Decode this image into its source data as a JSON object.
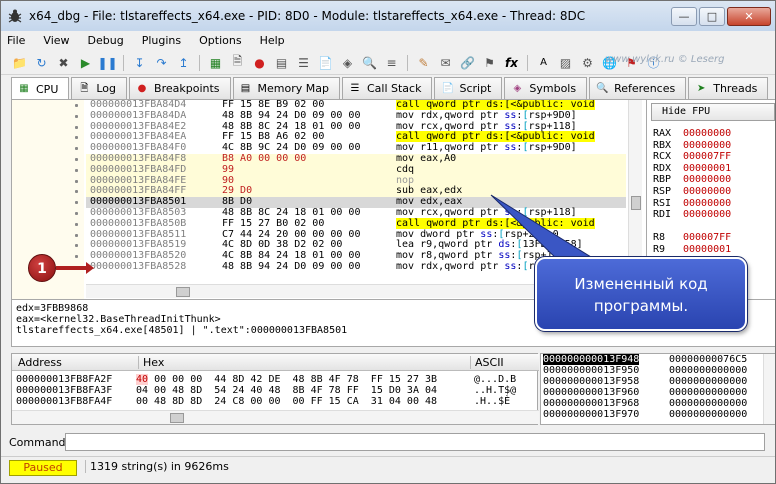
{
  "window": {
    "title": "x64_dbg - File: tlstareffects_x64.exe - PID: 8D0 - Module: tlstareffects_x64.exe - Thread: 8DC"
  },
  "menu": [
    "File",
    "View",
    "Debug",
    "Plugins",
    "Options",
    "Help"
  ],
  "watermark": "www.wylek.ru © Leserg",
  "tabs": [
    {
      "label": "CPU",
      "icon": "cpu-icon",
      "active": true
    },
    {
      "label": "Log",
      "icon": "log-icon"
    },
    {
      "label": "Breakpoints",
      "icon": "breakpoint-icon"
    },
    {
      "label": "Memory Map",
      "icon": "memory-icon"
    },
    {
      "label": "Call Stack",
      "icon": "callstack-icon"
    },
    {
      "label": "Script",
      "icon": "script-icon"
    },
    {
      "label": "Symbols",
      "icon": "symbols-icon"
    },
    {
      "label": "References",
      "icon": "references-icon"
    },
    {
      "label": "Threads",
      "icon": "threads-icon"
    }
  ],
  "disasm": [
    {
      "addr": "000000013FBA84D4",
      "bytes": "FF 15 8E B9 02 00",
      "instr": "call qword ptr ds:[<&public: void",
      "kind": "call"
    },
    {
      "addr": "000000013FBA84DA",
      "bytes": "48 8B 94 24 D0 09 00 00",
      "instr": "mov rdx,qword ptr ss:[rsp+9D0]"
    },
    {
      "addr": "000000013FBA84E2",
      "bytes": "48 8B 8C 24 18 01 00 00",
      "instr": "mov rcx,qword ptr ss:[rsp+118]"
    },
    {
      "addr": "000000013FBA84EA",
      "bytes": "FF 15 B8 A6 02 00",
      "instr": "call qword ptr ds:[<&public: void",
      "kind": "call"
    },
    {
      "addr": "000000013FBA84F0",
      "bytes": "4C 8B 9C 24 D0 09 00 00",
      "instr": "mov r11,qword ptr ss:[rsp+9D0]"
    },
    {
      "addr": "000000013FBA84F8",
      "bytes": "B8 A0 00 00 00",
      "instr": "mov eax,A0",
      "kind": "mod"
    },
    {
      "addr": "000000013FBA84FD",
      "bytes": "99",
      "instr": "cdq",
      "kind": "mod"
    },
    {
      "addr": "000000013FBA84FE",
      "bytes": "90",
      "instr": "nop",
      "kind": "mod"
    },
    {
      "addr": "000000013FBA84FF",
      "bytes": "29 D0",
      "instr": "sub eax,edx",
      "kind": "mod"
    },
    {
      "addr": "000000013FBA8501",
      "bytes": "8B D0",
      "instr": "mov edx,eax",
      "kind": "sel"
    },
    {
      "addr": "000000013FBA8503",
      "bytes": "48 8B 8C 24 18 01 00 00",
      "instr": "mov rcx,qword ptr ss:[rsp+118]"
    },
    {
      "addr": "000000013FBA850B",
      "bytes": "FF 15 27 B0 02 00",
      "instr": "call qword ptr ds:[<&public: void",
      "kind": "call"
    },
    {
      "addr": "000000013FBA8511",
      "bytes": "C7 44 24 20 00 00 00 00",
      "instr": "mov dword ptr ss:[rsp+20],0"
    },
    {
      "addr": "000000013FBA8519",
      "bytes": "4C 8D 0D 38 D2 02 00",
      "instr": "lea r9,qword ptr ds:[13FBD5758]"
    },
    {
      "addr": "000000013FBA8520",
      "bytes": "4C 8B 84 24 18 01 00 00",
      "instr": "mov r8,qword ptr ss:[rsp+118]"
    },
    {
      "addr": "000000013FBA8528",
      "bytes": "48 8B 94 24 D0 09 00 00",
      "instr": "mov rdx,qword ptr ss:[rsp+9D0]"
    }
  ],
  "registers": {
    "hide_fpu": "Hide FPU",
    "rows": [
      {
        "name": "RAX",
        "value": "00000000"
      },
      {
        "name": "RBX",
        "value": "00000000"
      },
      {
        "name": "RCX",
        "value": "000007FF"
      },
      {
        "name": "RDX",
        "value": "00000001"
      },
      {
        "name": "RBP",
        "value": "00000000"
      },
      {
        "name": "RSP",
        "value": "00000000"
      },
      {
        "name": "RSI",
        "value": "00000000"
      },
      {
        "name": "RDI",
        "value": "00000000"
      },
      {
        "name": "",
        "value": ""
      },
      {
        "name": "R8",
        "value": "000007FF"
      },
      {
        "name": "R9",
        "value": "00000001"
      }
    ]
  },
  "info": [
    "edx=3FBB9868",
    "eax=<kernel32.BaseThreadInitThunk>",
    "tlstareffects_x64.exe[48501] | \".text\":000000013FBA8501"
  ],
  "marker": "1",
  "callout": "Измененный код программы.",
  "dump": {
    "headers": {
      "address": "Address",
      "hex": "Hex",
      "ascii": "ASCII"
    },
    "rows": [
      {
        "addr": "000000013FB8FA2F",
        "hex_first": "40",
        "hex_rest": " 00 00 00  44 8D 42 DE  48 8B 4F 78  FF 15 27 3B",
        "ascii": "@...D.B"
      },
      {
        "addr": "000000013FB8FA3F",
        "hex_first": "",
        "hex_rest": "04 00 48 8D  54 24 40 48  8B 4F 78 FF  15 D0 3A 04",
        "ascii": "..H.T$@"
      },
      {
        "addr": "000000013FB8FA4F",
        "hex_first": "",
        "hex_rest": "00 48 8D 8D  24 C8 00 00  00 FF 15 CA  31 04 00 48",
        "ascii": ".H..$È"
      }
    ]
  },
  "stack": [
    {
      "addr": "000000000013F948",
      "val": "00000000076C5",
      "top": true
    },
    {
      "addr": "000000000013F950",
      "val": "0000000000000"
    },
    {
      "addr": "000000000013F958",
      "val": "0000000000000"
    },
    {
      "addr": "000000000013F960",
      "val": "0000000000000"
    },
    {
      "addr": "000000000013F968",
      "val": "0000000000000"
    },
    {
      "addr": "000000000013F970",
      "val": "0000000000000"
    }
  ],
  "command": {
    "label": "Command:",
    "value": ""
  },
  "status": {
    "state": "Paused",
    "text": "1319 string(s) in 9626ms"
  }
}
